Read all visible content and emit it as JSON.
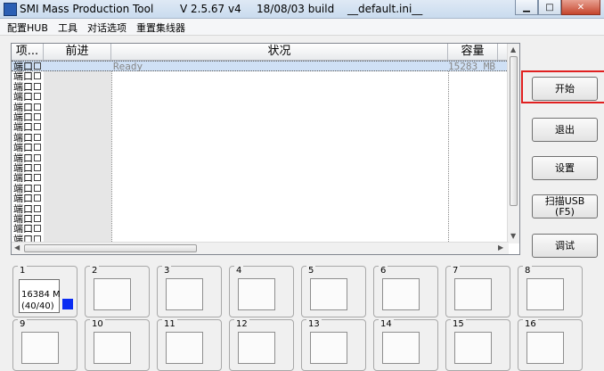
{
  "titlebar": {
    "app_title": "SMI Mass Production Tool",
    "version": "V 2.5.67   v4",
    "build": "18/08/03 build",
    "ini_file": "__default.ini__"
  },
  "menu": [
    "配置HUB",
    "工具",
    "对话选项",
    "重置集线器"
  ],
  "table": {
    "columns": [
      "项...",
      "前进",
      "状况",
      "容量"
    ],
    "rows": [
      {
        "port": "端口",
        "status": "Ready",
        "capacity": "15283 MB"
      },
      {
        "port": "端口"
      },
      {
        "port": "端口"
      },
      {
        "port": "端口"
      },
      {
        "port": "端口"
      },
      {
        "port": "端口"
      },
      {
        "port": "端口"
      },
      {
        "port": "端口"
      },
      {
        "port": "端口"
      },
      {
        "port": "端口"
      },
      {
        "port": "端口"
      },
      {
        "port": "端口"
      },
      {
        "port": "端口"
      },
      {
        "port": "端口"
      },
      {
        "port": "端口"
      },
      {
        "port": "端口"
      },
      {
        "port": "端口"
      },
      {
        "port": "端口"
      }
    ]
  },
  "buttons": {
    "start": "开始",
    "exit": "退出",
    "settings": "设置",
    "scan_line1": "扫描USB",
    "scan_line2": "(F5)",
    "debug": "调试"
  },
  "ports": [
    {
      "num": "1",
      "capacity": "16384 M",
      "progress": "(40/40)",
      "indicator_color": "#0a2cf2"
    },
    {
      "num": "2"
    },
    {
      "num": "3"
    },
    {
      "num": "4"
    },
    {
      "num": "5"
    },
    {
      "num": "6"
    },
    {
      "num": "7"
    },
    {
      "num": "8"
    },
    {
      "num": "9"
    },
    {
      "num": "10"
    },
    {
      "num": "11"
    },
    {
      "num": "12"
    },
    {
      "num": "13"
    },
    {
      "num": "14"
    },
    {
      "num": "15"
    },
    {
      "num": "16"
    }
  ]
}
